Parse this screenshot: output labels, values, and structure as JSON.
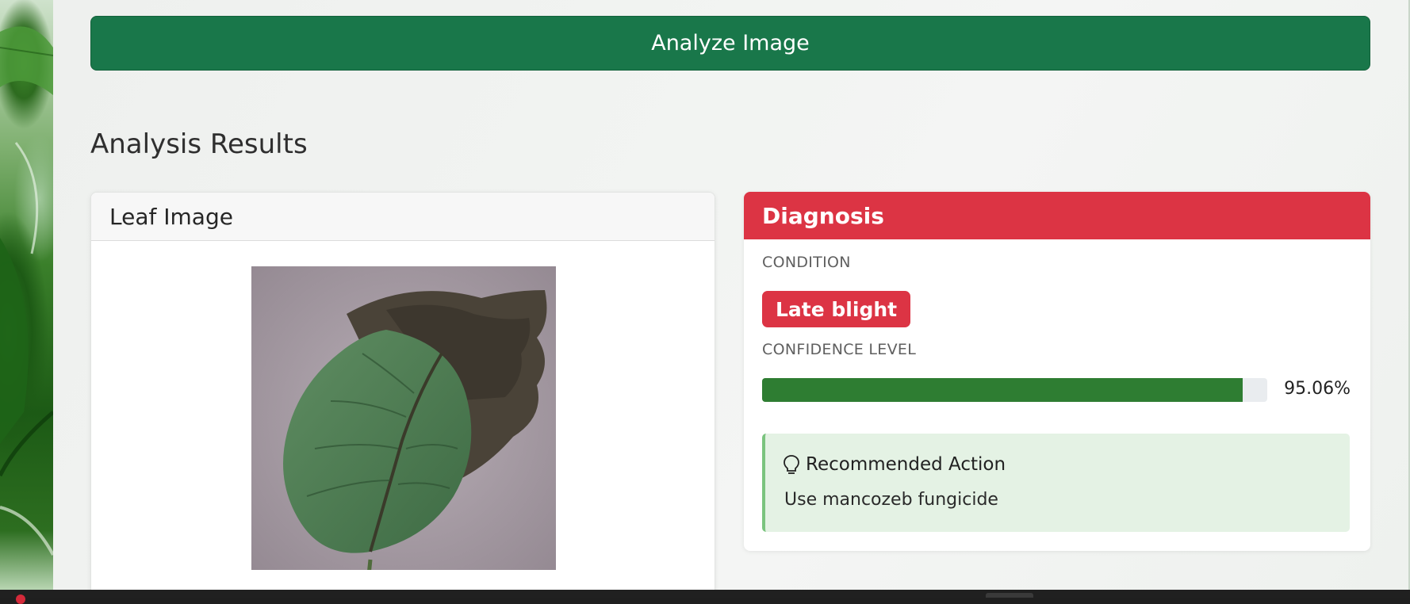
{
  "analyze_button": {
    "label": "Analyze Image"
  },
  "results": {
    "title": "Analysis Results",
    "leaf_card": {
      "title": "Leaf Image",
      "image_icon": "leaf-photo"
    },
    "diagnosis_card": {
      "title": "Diagnosis",
      "condition_label": "CONDITION",
      "condition_value": "Late blight",
      "confidence_label": "CONFIDENCE LEVEL",
      "confidence_value": "95.06%",
      "confidence_fraction": 0.9506,
      "recommendation": {
        "icon": "lightbulb-icon",
        "title": "Recommended Action",
        "text": "Use mancozeb fungicide"
      }
    }
  },
  "colors": {
    "primary_green": "#19774a",
    "danger_red": "#dc3444",
    "progress_green": "#2e7d32",
    "alert_bg": "#e4f2e4"
  }
}
